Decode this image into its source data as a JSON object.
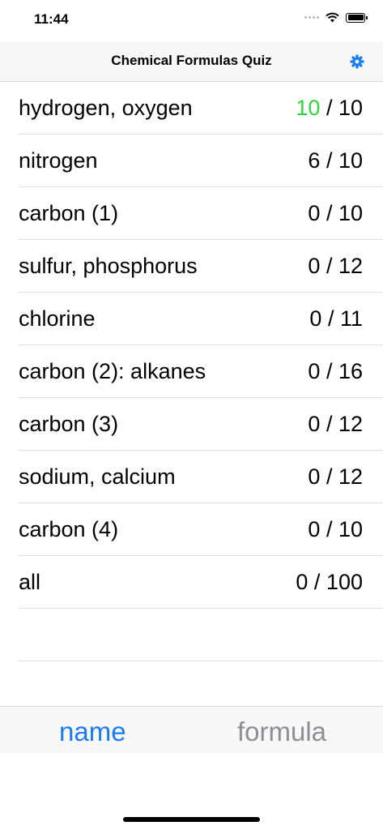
{
  "status_bar": {
    "time": "11:44"
  },
  "nav": {
    "title": "Chemical Formulas Quiz",
    "settings_icon": "gear-icon",
    "accent": "#1a7cf2"
  },
  "quizzes": [
    {
      "label": "hydrogen, oxygen",
      "correct": "10",
      "total": "10",
      "correct_color": "#2fd63a"
    },
    {
      "label": "nitrogen",
      "correct": "6",
      "total": "10"
    },
    {
      "label": "carbon (1)",
      "correct": "0",
      "total": "10"
    },
    {
      "label": "sulfur, phosphorus",
      "correct": "0",
      "total": "12"
    },
    {
      "label": "chlorine",
      "correct": "0",
      "total": "11"
    },
    {
      "label": "carbon (2): alkanes",
      "correct": "0",
      "total": "16"
    },
    {
      "label": "carbon (3)",
      "correct": "0",
      "total": "12"
    },
    {
      "label": "sodium, calcium",
      "correct": "0",
      "total": "12"
    },
    {
      "label": "carbon (4)",
      "correct": "0",
      "total": "10"
    },
    {
      "label": "all",
      "correct": "0",
      "total": "100"
    }
  ],
  "tabs": {
    "name_label": "name",
    "formula_label": "formula",
    "selected": "name",
    "selected_color": "#1a7cf2",
    "unselected_color": "#8e8e93"
  }
}
